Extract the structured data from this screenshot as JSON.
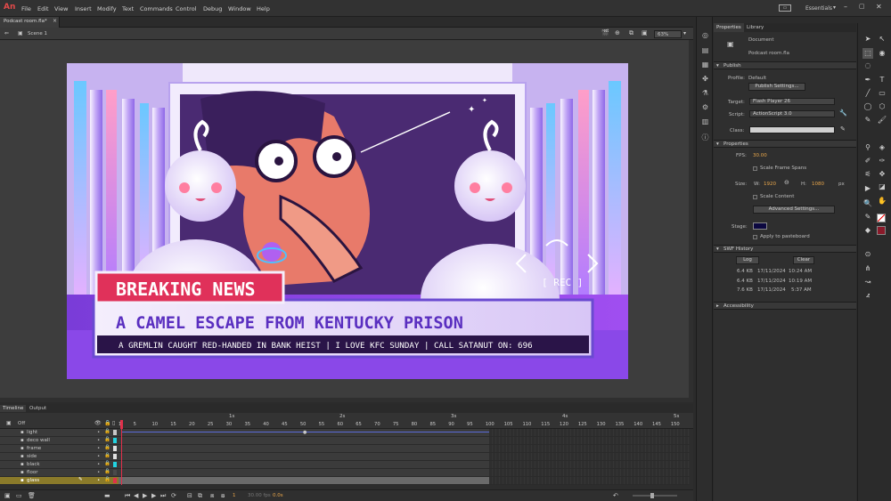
{
  "app": {
    "logo": "An"
  },
  "menu": [
    "File",
    "Edit",
    "View",
    "Insert",
    "Modify",
    "Text",
    "Commands",
    "Control",
    "Debug",
    "Window",
    "Help"
  ],
  "workspace": {
    "label": "Essentials"
  },
  "document": {
    "tab": "Podcast room.fla*",
    "scene": "Scene 1",
    "zoom": "63%"
  },
  "stage_art": {
    "headline_tag": "BREAKING NEWS",
    "headline": "A CAMEL ESCAPE FROM KENTUCKY PRISON",
    "ticker": "A GREMLIN CAUGHT RED-HANDED IN BANK HEIST | I LOVE KFC SUNDAY | CALL SATANUT ON: 696",
    "rec_label": "[ REC ]"
  },
  "timeline": {
    "tabs": [
      "Timeline",
      "Output"
    ],
    "toggle": "Off",
    "seconds": [
      "1s",
      "2s",
      "3s",
      "4s",
      "5s"
    ],
    "frame_numbers": [
      "1",
      "5",
      "10",
      "15",
      "20",
      "25",
      "30",
      "35",
      "40",
      "45",
      "50",
      "55",
      "60",
      "65",
      "70",
      "75",
      "80",
      "85",
      "90",
      "95",
      "100",
      "105",
      "110",
      "115",
      "120",
      "125",
      "130",
      "135",
      "140",
      "145",
      "150"
    ],
    "layers": [
      "light",
      "deco wall",
      "frame",
      "side",
      "black",
      "floor",
      "glass"
    ],
    "current_frame": "1",
    "fps": "30.00 fps",
    "time": "0.0s"
  },
  "properties": {
    "tabs": [
      "Properties",
      "Library"
    ],
    "doc_type": "Document",
    "doc_name": "Podcast room.fla",
    "publish": {
      "header": "Publish",
      "profile_label": "Profile:",
      "profile": "Default",
      "settings_btn": "Publish Settings...",
      "target_label": "Target:",
      "target": "Flash Player 26",
      "script_label": "Script:",
      "script": "ActionScript 3.0",
      "class_label": "Class:"
    },
    "props": {
      "header": "Properties",
      "fps_label": "FPS:",
      "fps": "30.00",
      "scale_spans": "Scale Frame Spans",
      "size_label": "Size:",
      "w_label": "W:",
      "w": "1920",
      "h_label": "H:",
      "h": "1080",
      "unit": "px",
      "scale_content": "Scale Content",
      "advanced_btn": "Advanced Settings...",
      "stage_label": "Stage:",
      "pasteboard": "Apply to pasteboard"
    },
    "swf": {
      "header": "SWF History",
      "log_btn": "Log",
      "clear_btn": "Clear",
      "rows": [
        {
          "size": "6.4 KB",
          "date": "17/11/2024",
          "time": "10:24 AM"
        },
        {
          "size": "6.4 KB",
          "date": "17/11/2024",
          "time": "10:19 AM"
        },
        {
          "size": "7.6 KB",
          "date": "17/11/2024",
          "time": "5:37 AM"
        }
      ]
    },
    "accessibility": "Accessibility"
  },
  "colors": {
    "stage_color": "#0c0840",
    "fill_color": "#8a1a2a",
    "accent": "#e34a4a",
    "selected_layer": "#8a7a2a"
  }
}
